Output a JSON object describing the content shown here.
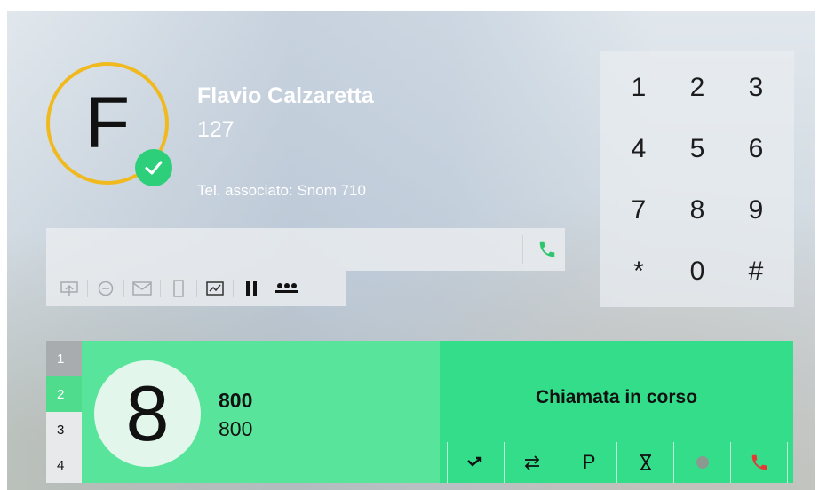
{
  "user": {
    "initial": "F",
    "name": "Flavio Calzaretta",
    "extension": "127",
    "associated_phone": "Tel. associato: Snom 710",
    "status_icon": "check-icon"
  },
  "dialer": {
    "value": "",
    "placeholder": "",
    "call_icon": "phone-icon"
  },
  "toolbar": {
    "buttons": [
      {
        "name": "forward-icon"
      },
      {
        "name": "do-not-disturb-icon"
      },
      {
        "name": "voicemail-icon"
      },
      {
        "name": "mobile-icon"
      },
      {
        "name": "statistics-icon"
      },
      {
        "name": "pause-icon"
      },
      {
        "name": "group-icon"
      }
    ]
  },
  "keypad": {
    "keys": [
      "1",
      "2",
      "3",
      "4",
      "5",
      "6",
      "7",
      "8",
      "9",
      "*",
      "0",
      "#"
    ]
  },
  "lines": {
    "tabs": [
      "1",
      "2",
      "3",
      "4"
    ],
    "active": "2"
  },
  "call": {
    "initial": "8",
    "name": "800",
    "number": "800",
    "status": "Chiamata in corso",
    "actions": [
      {
        "name": "transfer-icon"
      },
      {
        "name": "swap-icon"
      },
      {
        "name": "park-label",
        "label": "P"
      },
      {
        "name": "hold-hourglass-icon"
      },
      {
        "name": "record-icon"
      },
      {
        "name": "hangup-icon"
      }
    ]
  },
  "colors": {
    "avatar_ring": "#f0b91e",
    "status_green": "#2ecf7a",
    "call_left_bg": "#58e49a",
    "call_right_bg": "#33dd89",
    "hangup_red": "#e53935"
  }
}
